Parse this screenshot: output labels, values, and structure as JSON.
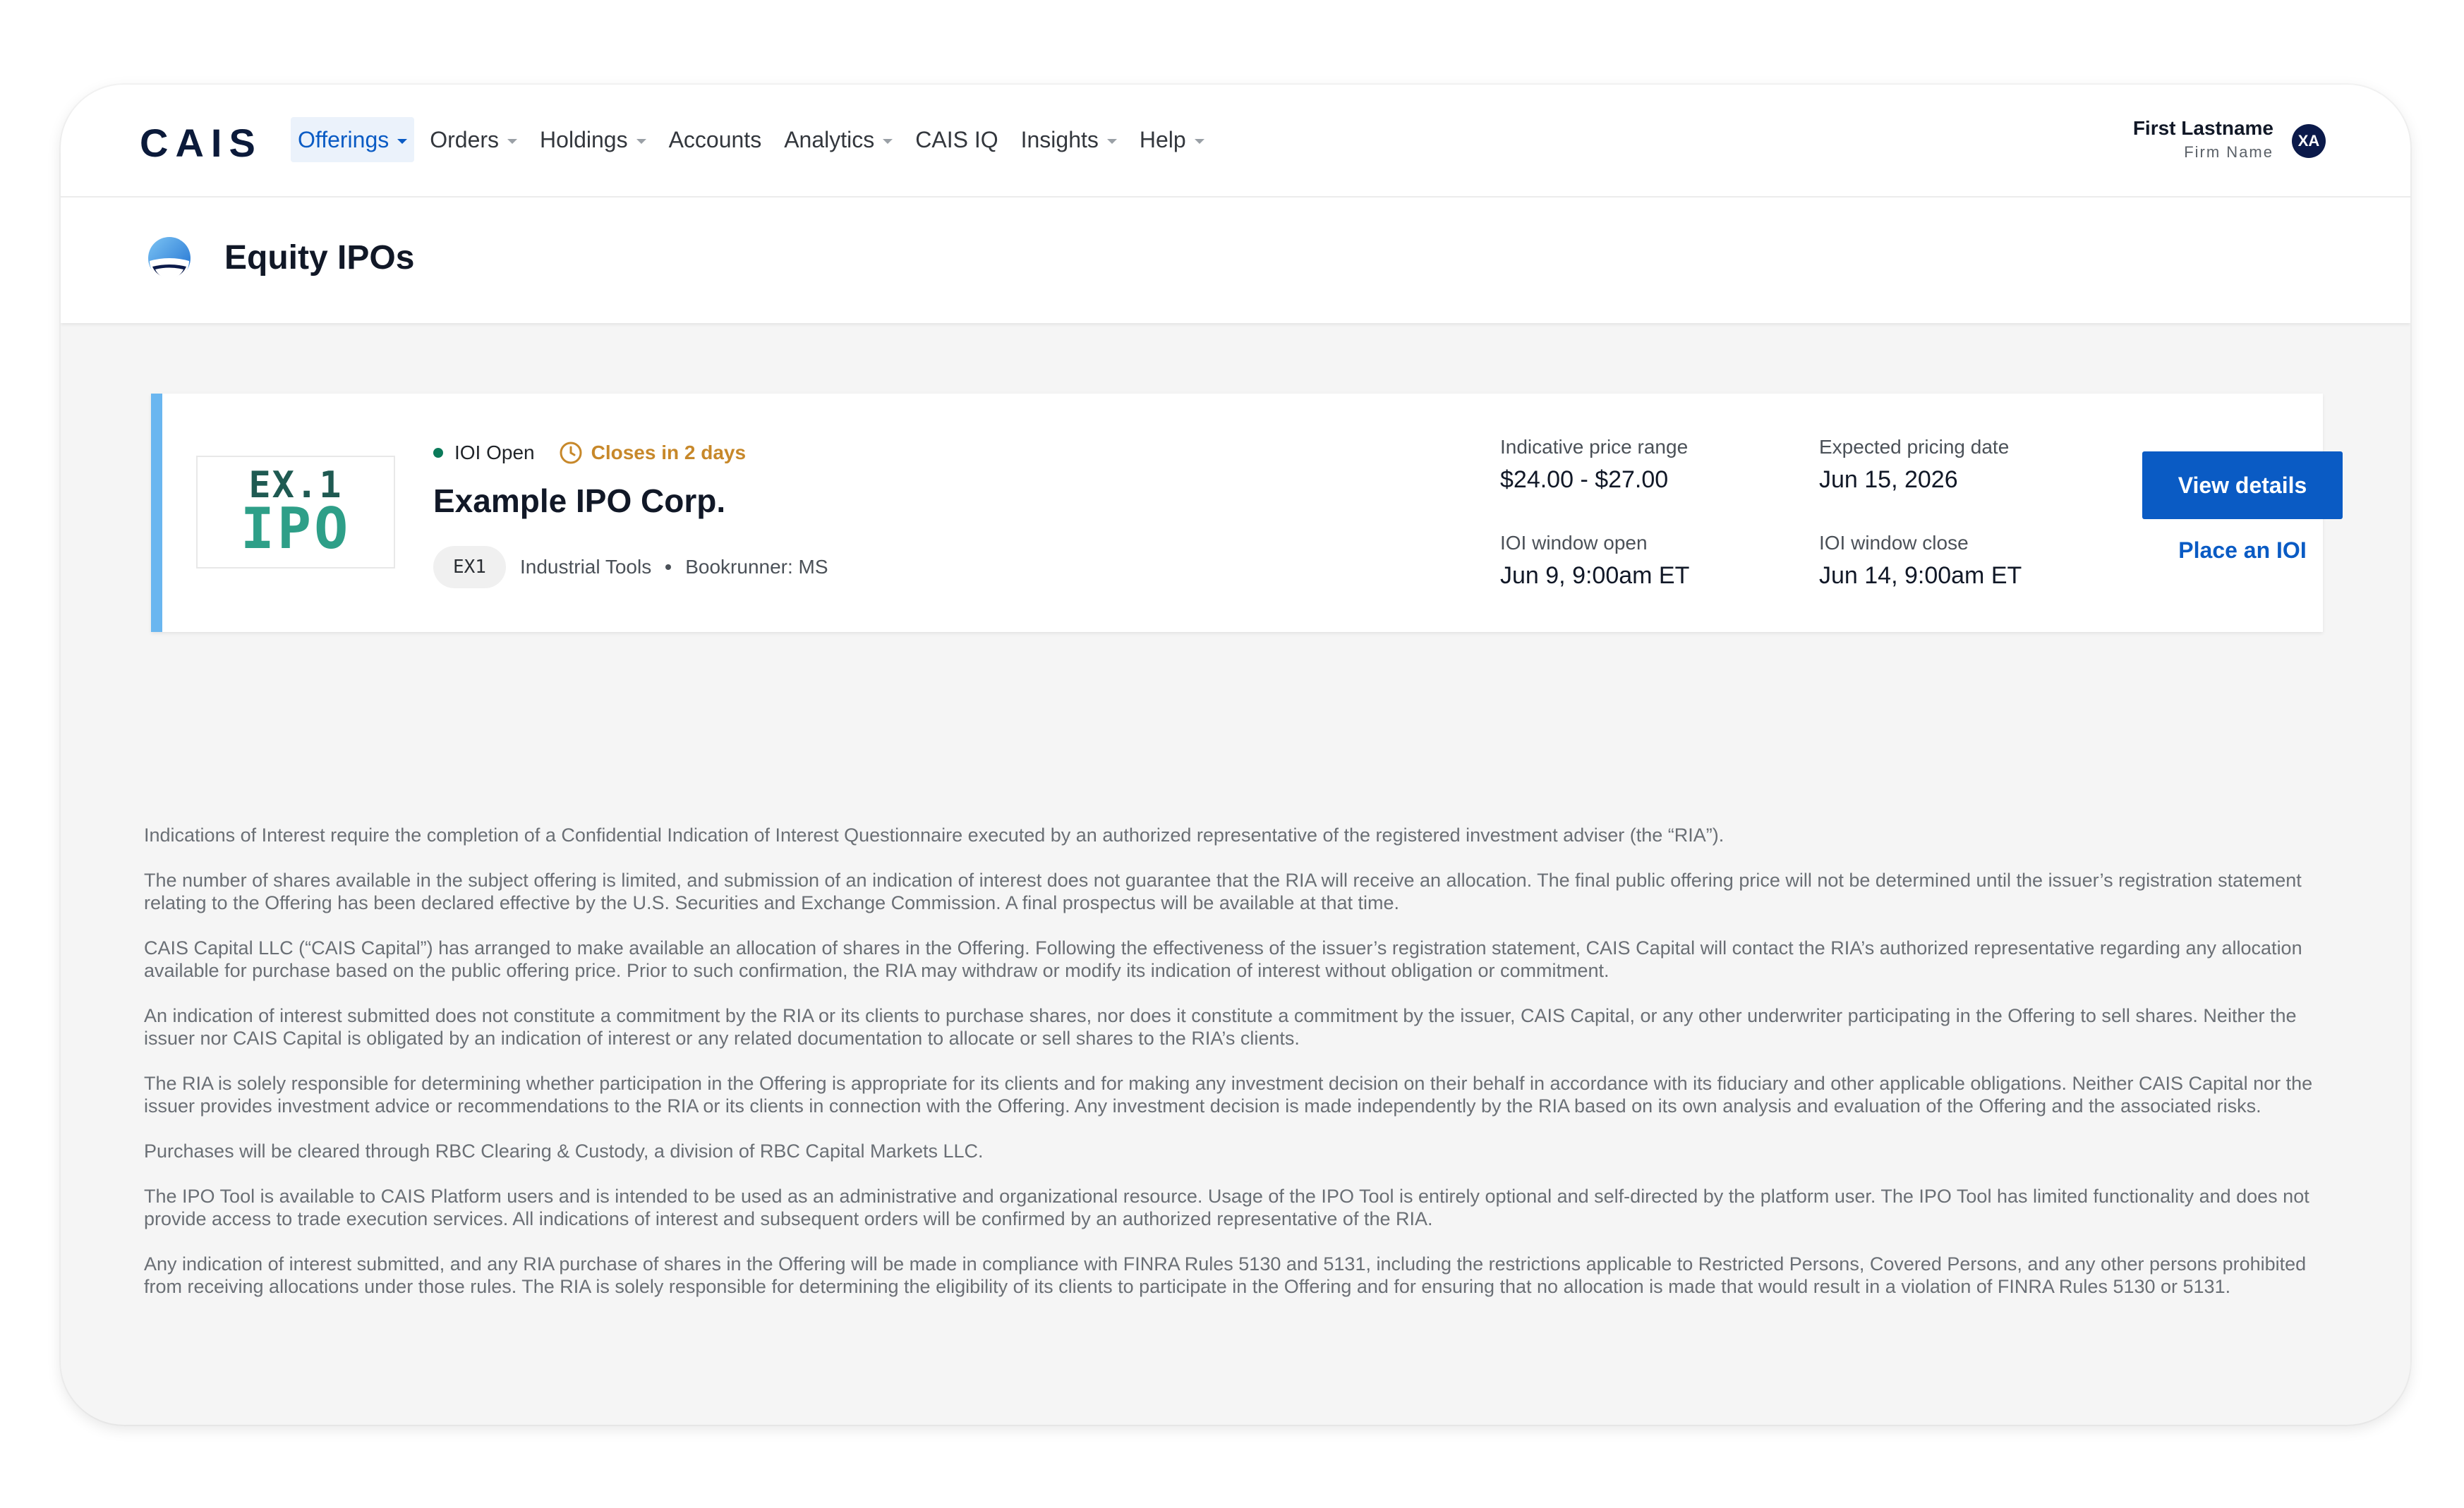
{
  "nav": {
    "logo": "CAIS",
    "menu": [
      {
        "label": "Offerings",
        "dropdown": true,
        "active": true
      },
      {
        "label": "Orders",
        "dropdown": true
      },
      {
        "label": "Holdings",
        "dropdown": true
      },
      {
        "label": "Accounts",
        "dropdown": false
      },
      {
        "label": "Analytics",
        "dropdown": true
      },
      {
        "label": "CAIS IQ",
        "dropdown": false
      },
      {
        "label": "Insights",
        "dropdown": true
      },
      {
        "label": "Help",
        "dropdown": true
      }
    ],
    "user": {
      "name": "First Lastname",
      "firm": "Firm Name",
      "initials": "XA"
    }
  },
  "page": {
    "title": "Equity IPOs",
    "icon": "globe-icon"
  },
  "offering": {
    "logo": {
      "line1": "EX.1",
      "line2": "IPO"
    },
    "status": "IOI Open",
    "status_color": "#0b7a5a",
    "closes": "Closes in 2 days",
    "closes_color": "#c7882a",
    "company": "Example IPO Corp.",
    "ticker": "EX1",
    "sector": "Industrial Tools",
    "bookrunner": "Bookrunner: MS",
    "price_range_label": "Indicative price range",
    "price_range_value": "$24.00 - $27.00",
    "pricing_date_label": "Expected pricing date",
    "pricing_date_value": "Jun 15, 2026",
    "window_open_label": "IOI window open",
    "window_open_value": "Jun 9, 9:00am ET",
    "window_close_label": "IOI window close",
    "window_close_value": "Jun 14, 9:00am ET",
    "view_details_label": "View details",
    "place_ioi_label": "Place an IOI",
    "accent_color": "#0a5bc4"
  },
  "disclaimer": [
    "Indications of Interest require the completion of a Confidential Indication of Interest Questionnaire executed by an authorized representative of the registered investment adviser (the “RIA”).",
    "The number of shares available in the subject offering is limited, and submission of an indication of interest does not guarantee that the RIA will receive an allocation. The final public offering price will not be determined until the issuer’s registration statement relating to the Offering has been declared effective by the U.S. Securities and Exchange Commission. A final prospectus will be available at that time.",
    "CAIS Capital LLC (“CAIS Capital”) has arranged to make available an allocation of shares in the Offering. Following the effectiveness of the issuer’s registration statement, CAIS Capital will contact the RIA’s authorized representative regarding any allocation available for purchase based on the public offering price. Prior to such confirmation, the RIA may withdraw or modify its indication of interest without obligation or commitment.",
    "An indication of interest submitted does not constitute a commitment by the RIA or its clients to purchase shares, nor does it constitute a commitment by the issuer, CAIS Capital, or any other underwriter participating in the Offering to sell shares. Neither the issuer nor CAIS Capital is obligated by an indication of interest or any related documentation to allocate or sell shares to the RIA’s clients.",
    "The RIA is solely responsible for determining whether participation in the Offering is appropriate for its clients and for making any investment decision on their behalf in accordance with its fiduciary and other applicable obligations. Neither CAIS Capital nor the issuer provides investment advice or recommendations to the RIA or its clients in connection with the Offering. Any investment decision is made independently by the RIA based on its own analysis and evaluation of the Offering and the associated risks.",
    "Purchases will be cleared through RBC Clearing & Custody, a division of RBC Capital Markets LLC.",
    "The IPO Tool is available to CAIS Platform users and is intended to be used as an administrative and organizational resource. Usage of the IPO Tool is entirely optional and self-directed by the platform user. The IPO Tool has limited functionality and does not provide access to trade execution services. All indications of interest and subsequent orders will be confirmed by an authorized representative of the RIA.",
    "Any indication of interest submitted, and any RIA purchase of shares in the Offering will be made in compliance with FINRA Rules 5130 and 5131, including the restrictions applicable to Restricted Persons, Covered Persons, and any other persons prohibited from receiving allocations under those rules. The RIA is solely responsible for determining the eligibility of its clients to participate in the Offering and for ensuring that no allocation is made that would result in a violation of FINRA Rules 5130 or 5131."
  ]
}
